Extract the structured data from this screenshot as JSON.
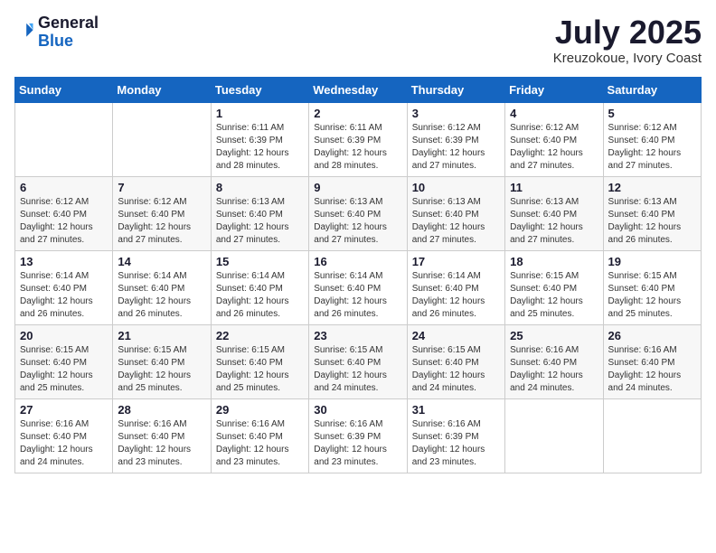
{
  "logo": {
    "general": "General",
    "blue": "Blue"
  },
  "header": {
    "month": "July 2025",
    "location": "Kreuzokoue, Ivory Coast"
  },
  "weekdays": [
    "Sunday",
    "Monday",
    "Tuesday",
    "Wednesday",
    "Thursday",
    "Friday",
    "Saturday"
  ],
  "weeks": [
    [
      {
        "day": "",
        "info": ""
      },
      {
        "day": "",
        "info": ""
      },
      {
        "day": "1",
        "sunrise": "6:11 AM",
        "sunset": "6:39 PM",
        "daylight": "12 hours and 28 minutes."
      },
      {
        "day": "2",
        "sunrise": "6:11 AM",
        "sunset": "6:39 PM",
        "daylight": "12 hours and 28 minutes."
      },
      {
        "day": "3",
        "sunrise": "6:12 AM",
        "sunset": "6:39 PM",
        "daylight": "12 hours and 27 minutes."
      },
      {
        "day": "4",
        "sunrise": "6:12 AM",
        "sunset": "6:40 PM",
        "daylight": "12 hours and 27 minutes."
      },
      {
        "day": "5",
        "sunrise": "6:12 AM",
        "sunset": "6:40 PM",
        "daylight": "12 hours and 27 minutes."
      }
    ],
    [
      {
        "day": "6",
        "sunrise": "6:12 AM",
        "sunset": "6:40 PM",
        "daylight": "12 hours and 27 minutes."
      },
      {
        "day": "7",
        "sunrise": "6:12 AM",
        "sunset": "6:40 PM",
        "daylight": "12 hours and 27 minutes."
      },
      {
        "day": "8",
        "sunrise": "6:13 AM",
        "sunset": "6:40 PM",
        "daylight": "12 hours and 27 minutes."
      },
      {
        "day": "9",
        "sunrise": "6:13 AM",
        "sunset": "6:40 PM",
        "daylight": "12 hours and 27 minutes."
      },
      {
        "day": "10",
        "sunrise": "6:13 AM",
        "sunset": "6:40 PM",
        "daylight": "12 hours and 27 minutes."
      },
      {
        "day": "11",
        "sunrise": "6:13 AM",
        "sunset": "6:40 PM",
        "daylight": "12 hours and 27 minutes."
      },
      {
        "day": "12",
        "sunrise": "6:13 AM",
        "sunset": "6:40 PM",
        "daylight": "12 hours and 26 minutes."
      }
    ],
    [
      {
        "day": "13",
        "sunrise": "6:14 AM",
        "sunset": "6:40 PM",
        "daylight": "12 hours and 26 minutes."
      },
      {
        "day": "14",
        "sunrise": "6:14 AM",
        "sunset": "6:40 PM",
        "daylight": "12 hours and 26 minutes."
      },
      {
        "day": "15",
        "sunrise": "6:14 AM",
        "sunset": "6:40 PM",
        "daylight": "12 hours and 26 minutes."
      },
      {
        "day": "16",
        "sunrise": "6:14 AM",
        "sunset": "6:40 PM",
        "daylight": "12 hours and 26 minutes."
      },
      {
        "day": "17",
        "sunrise": "6:14 AM",
        "sunset": "6:40 PM",
        "daylight": "12 hours and 26 minutes."
      },
      {
        "day": "18",
        "sunrise": "6:15 AM",
        "sunset": "6:40 PM",
        "daylight": "12 hours and 25 minutes."
      },
      {
        "day": "19",
        "sunrise": "6:15 AM",
        "sunset": "6:40 PM",
        "daylight": "12 hours and 25 minutes."
      }
    ],
    [
      {
        "day": "20",
        "sunrise": "6:15 AM",
        "sunset": "6:40 PM",
        "daylight": "12 hours and 25 minutes."
      },
      {
        "day": "21",
        "sunrise": "6:15 AM",
        "sunset": "6:40 PM",
        "daylight": "12 hours and 25 minutes."
      },
      {
        "day": "22",
        "sunrise": "6:15 AM",
        "sunset": "6:40 PM",
        "daylight": "12 hours and 25 minutes."
      },
      {
        "day": "23",
        "sunrise": "6:15 AM",
        "sunset": "6:40 PM",
        "daylight": "12 hours and 24 minutes."
      },
      {
        "day": "24",
        "sunrise": "6:15 AM",
        "sunset": "6:40 PM",
        "daylight": "12 hours and 24 minutes."
      },
      {
        "day": "25",
        "sunrise": "6:16 AM",
        "sunset": "6:40 PM",
        "daylight": "12 hours and 24 minutes."
      },
      {
        "day": "26",
        "sunrise": "6:16 AM",
        "sunset": "6:40 PM",
        "daylight": "12 hours and 24 minutes."
      }
    ],
    [
      {
        "day": "27",
        "sunrise": "6:16 AM",
        "sunset": "6:40 PM",
        "daylight": "12 hours and 24 minutes."
      },
      {
        "day": "28",
        "sunrise": "6:16 AM",
        "sunset": "6:40 PM",
        "daylight": "12 hours and 23 minutes."
      },
      {
        "day": "29",
        "sunrise": "6:16 AM",
        "sunset": "6:40 PM",
        "daylight": "12 hours and 23 minutes."
      },
      {
        "day": "30",
        "sunrise": "6:16 AM",
        "sunset": "6:39 PM",
        "daylight": "12 hours and 23 minutes."
      },
      {
        "day": "31",
        "sunrise": "6:16 AM",
        "sunset": "6:39 PM",
        "daylight": "12 hours and 23 minutes."
      },
      {
        "day": "",
        "info": ""
      },
      {
        "day": "",
        "info": ""
      }
    ]
  ],
  "labels": {
    "sunrise": "Sunrise:",
    "sunset": "Sunset:",
    "daylight": "Daylight:"
  }
}
